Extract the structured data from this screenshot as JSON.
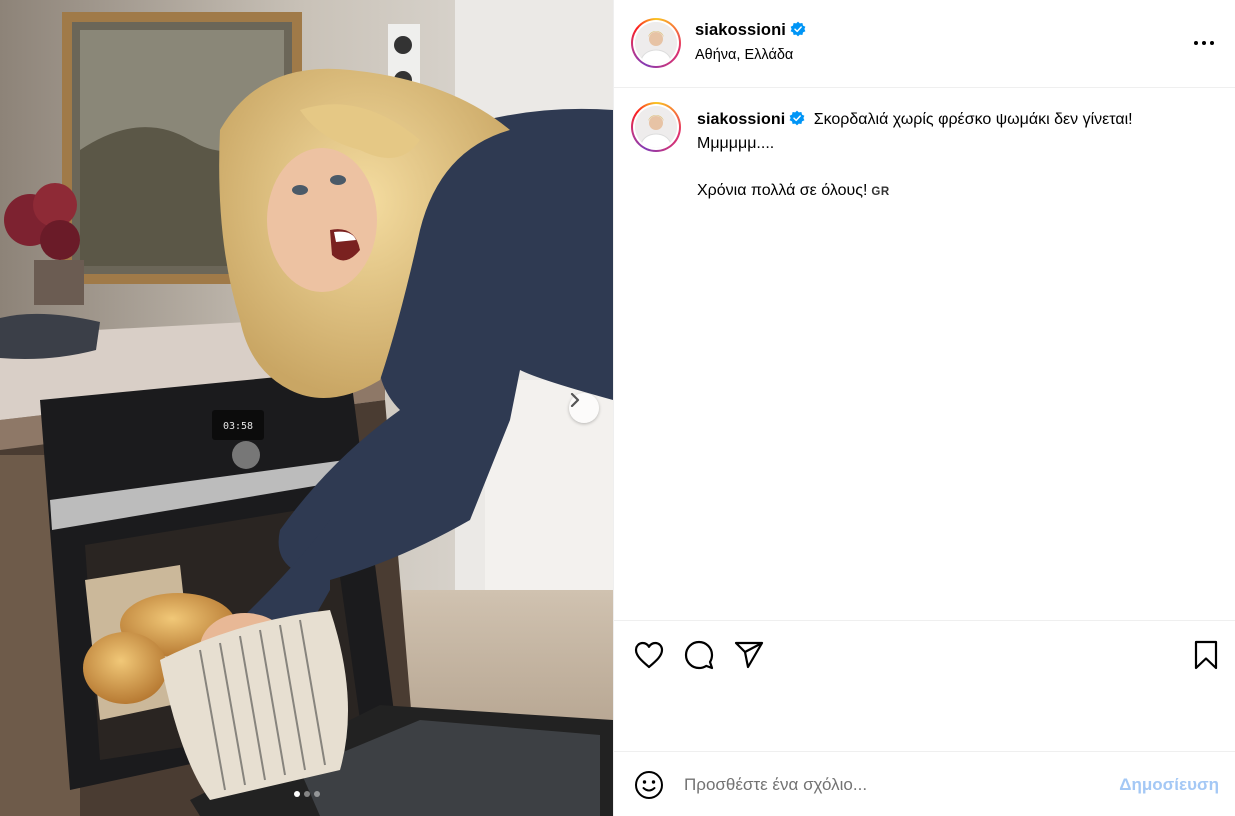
{
  "post": {
    "username": "siakossioni",
    "location": "Αθήνα, Ελλάδα",
    "caption_line1": "Σκορδαλιά χωρίς φρέσκο ψωμάκι δεν γίνεται!",
    "caption_line2": "Μμμμμμ....",
    "caption_line3": "Χρόνια πολλά σε όλους!",
    "caption_flag": "GR"
  },
  "media": {
    "oven_clock": "03:58",
    "carousel_count": 3,
    "carousel_active": 0
  },
  "actions": {
    "like": "heart-icon",
    "comment": "comment-icon",
    "share": "share-icon",
    "save": "bookmark-icon"
  },
  "comment_box": {
    "placeholder": "Προσθέστε ένα σχόλιο...",
    "post_label": "Δημοσίευση"
  },
  "colors": {
    "verified": "#0095f6",
    "post_button_disabled": "#a4c8f5",
    "divider": "#efefef"
  }
}
